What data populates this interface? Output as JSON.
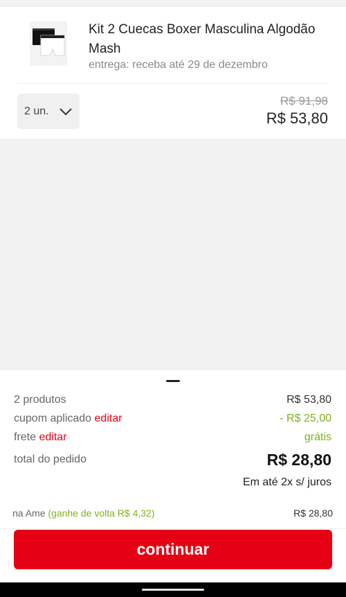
{
  "product": {
    "title": "Kit 2 Cuecas Boxer Masculina Algodão Mash",
    "delivery": "entrega: receba até 29 de dezembro",
    "quantity": "2 un.",
    "old_price": "R$ 91,98",
    "price": "R$ 53,80"
  },
  "summary": {
    "products_label": "2 produtos",
    "products_value": "R$ 53,80",
    "coupon_label": "cupom aplicado",
    "coupon_edit": "editar",
    "coupon_value": "- R$ 25,00",
    "shipping_label": "frete",
    "shipping_edit": "editar",
    "shipping_value": "grátis",
    "total_label": "total do pedido",
    "total_value": "R$ 28,80",
    "installments": "Em até 2x s/ juros",
    "ame_label": "na Ame",
    "ame_cashback": "(ganhe de volta R$ 4,32)",
    "ame_value": "R$ 28,80"
  },
  "actions": {
    "continue": "continuar"
  },
  "colors": {
    "accent": "#e60014",
    "discount": "#7ab317"
  }
}
